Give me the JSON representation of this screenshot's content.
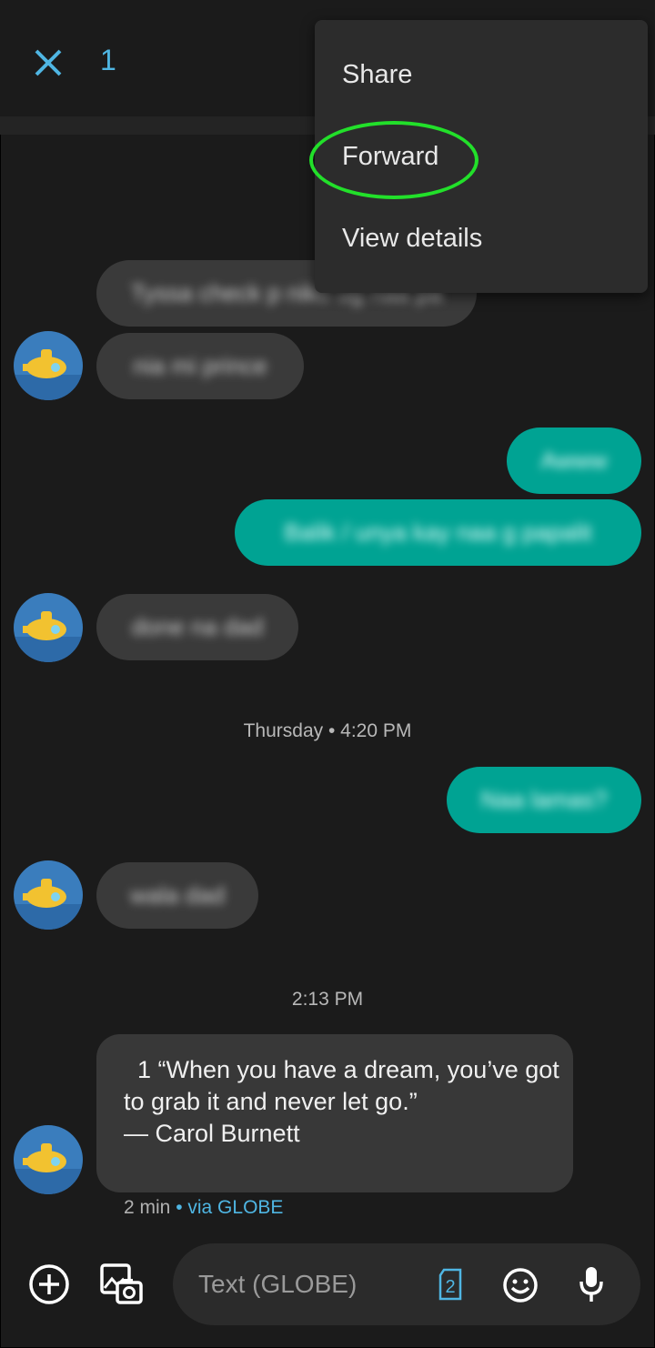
{
  "header": {
    "selected_count": "1"
  },
  "menu": {
    "items": [
      "Share",
      "Forward",
      "View details"
    ]
  },
  "messages": {
    "m1": "Tyssa check p niko ug naa pa",
    "m2": "nia mi prince",
    "m3": "Awww",
    "m4": "Balik / unya kay naa g papalit",
    "m5": "done na dad",
    "m6": "Naa lamas?",
    "m7": "wala dad"
  },
  "timestamps": {
    "t1": "Thursday • 4:20 PM",
    "t2": "2:13 PM"
  },
  "quote": {
    "text": "  1 “When you have a dream, you’ve got to grab it and never let go.”\n— Carol Burnett",
    "time": "2 min",
    "via": " • via GLOBE"
  },
  "composer": {
    "placeholder": "Text (GLOBE)",
    "sim_number": "2"
  },
  "colors": {
    "accent": "#4fb6e3",
    "outgoing": "#00a393",
    "incoming": "#3a3a3a",
    "highlight": "#22e02a"
  },
  "icons": [
    "close-icon",
    "add-icon",
    "gallery-camera-icon",
    "sim-card-icon",
    "emoji-icon",
    "microphone-icon",
    "submarine-avatar-icon"
  ]
}
